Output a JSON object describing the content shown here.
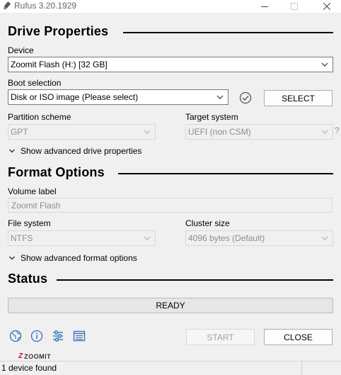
{
  "window": {
    "title": "Rufus 3.20.1929"
  },
  "drive_properties": {
    "heading": "Drive Properties",
    "device_label": "Device",
    "device_value": "Zoomit Flash (H:) [32 GB]",
    "boot_selection_label": "Boot selection",
    "boot_selection_value": "Disk or ISO image (Please select)",
    "select_button": "SELECT",
    "partition_scheme_label": "Partition scheme",
    "partition_scheme_value": "GPT",
    "target_system_label": "Target system",
    "target_system_value": "UEFI (non CSM)",
    "advanced_toggle": "Show advanced drive properties"
  },
  "format_options": {
    "heading": "Format Options",
    "volume_label_label": "Volume label",
    "volume_label_value": "Zoomit Flash",
    "file_system_label": "File system",
    "file_system_value": "NTFS",
    "cluster_size_label": "Cluster size",
    "cluster_size_value": "4096 bytes (Default)",
    "advanced_toggle": "Show advanced format options"
  },
  "status": {
    "heading": "Status",
    "progress_text": "READY"
  },
  "footer": {
    "start_button": "START",
    "close_button": "CLOSE",
    "watermark": "ZOOMIT",
    "status_bar_text": "1 device found"
  },
  "icons": {
    "title": "usb-drive-icon",
    "language": "globe-icon",
    "about": "info-icon",
    "settings": "sliders-icon",
    "log": "log-icon",
    "checksum": "check-circle-icon"
  },
  "colors": {
    "accent": "#2a6ebd",
    "watermark_red": "#d0102b"
  }
}
